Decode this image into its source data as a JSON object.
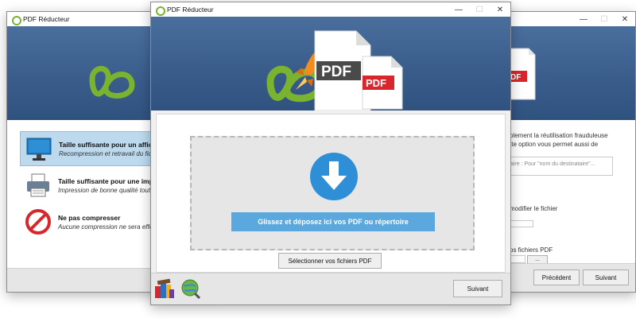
{
  "app": {
    "title": "PDF Réducteur"
  },
  "window_controls": {
    "minimize": "—",
    "maximize": "☐",
    "close": "✕"
  },
  "left_window": {
    "options": [
      {
        "title": "Taille suffisante pour un affichage",
        "desc": "Recompression et retravail du fichier",
        "icon": "monitor-icon",
        "selected": true
      },
      {
        "title": "Taille suffisante pour une impressi",
        "desc": "Impression de bonne qualité tout en",
        "icon": "printer-icon",
        "selected": false
      },
      {
        "title": "Ne pas compresser",
        "desc": "Aucune compression ne sera effectu",
        "icon": "no-entry-icon",
        "selected": false
      }
    ]
  },
  "right_window": {
    "text1_line1": "blement la réutilisation frauduleuse",
    "text1_line2": "tte option vous permet aussi de",
    "recipient_placeholder": "taire : Pour \"nom du destinataire\"...",
    "modify_label": "modifier le fichier",
    "files_label": "os fichiers PDF",
    "browse_label": "...",
    "previous_label": "Précédent",
    "next_label": "Suivant"
  },
  "main_window": {
    "banner_pdf_large": "PDF",
    "banner_pdf_small": "PDF",
    "drop_label": "Glissez et déposez ici vos PDF ou répertoire",
    "select_button": "Sélectionner vos fichiers PDF",
    "next_button": "Suivant"
  },
  "colors": {
    "banner": "#3f6592",
    "accent_blue": "#2e8fd6",
    "drop_bar": "#5ba8de",
    "logo_green": "#7ab330",
    "rocket_orange": "#f28c1e",
    "pdf_red": "#d8262c"
  },
  "icons": [
    "app-logo-icon",
    "rocket-icon",
    "pdf-document-icon",
    "download-arrow-icon",
    "books-icon",
    "globe-search-icon",
    "monitor-icon",
    "printer-icon",
    "no-entry-icon"
  ]
}
